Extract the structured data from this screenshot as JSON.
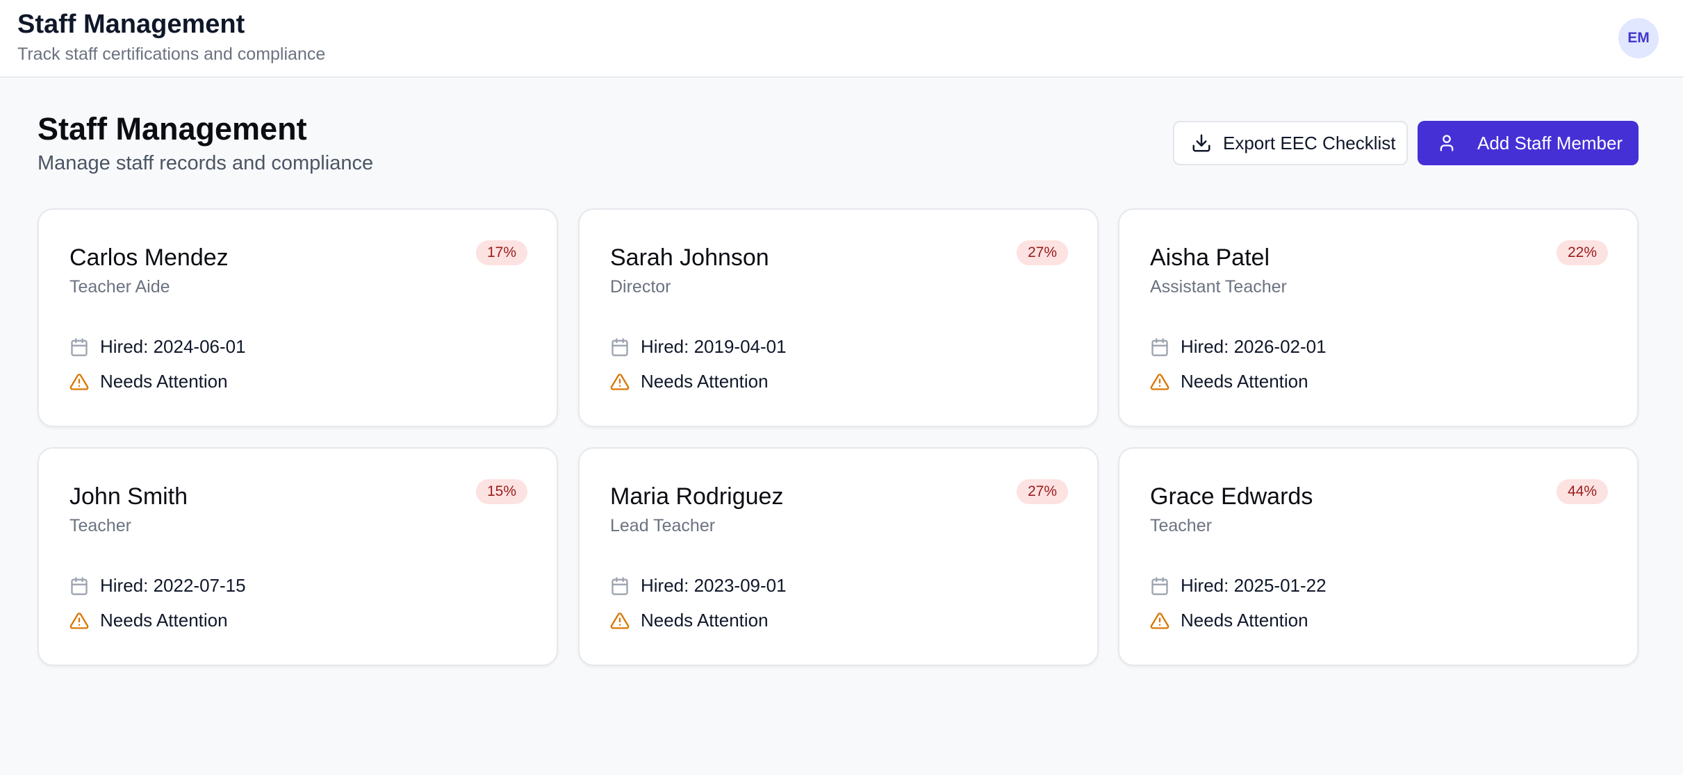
{
  "header": {
    "title": "Staff Management",
    "subtitle": "Track staff certifications and compliance",
    "avatar_initials": "EM"
  },
  "page": {
    "title": "Staff Management",
    "subtitle": "Manage staff records and compliance"
  },
  "actions": {
    "export_label": "Export EEC Checklist",
    "add_label": "Add Staff Member"
  },
  "colors": {
    "accent": "#4530d6",
    "badge_bg": "#fde2e2",
    "badge_text": "#991b1b",
    "warning": "#d97706"
  },
  "icons": {
    "export": "download-icon",
    "add": "user-icon",
    "hired": "calendar-icon",
    "status": "warning-triangle-icon"
  },
  "staff": [
    {
      "name": "Carlos Mendez",
      "role": "Teacher Aide",
      "percent": "17%",
      "hired": "Hired: 2024-06-01",
      "status": "Needs Attention"
    },
    {
      "name": "Sarah Johnson",
      "role": "Director",
      "percent": "27%",
      "hired": "Hired: 2019-04-01",
      "status": "Needs Attention"
    },
    {
      "name": "Aisha Patel",
      "role": "Assistant Teacher",
      "percent": "22%",
      "hired": "Hired: 2026-02-01",
      "status": "Needs Attention"
    },
    {
      "name": "John Smith",
      "role": "Teacher",
      "percent": "15%",
      "hired": "Hired: 2022-07-15",
      "status": "Needs Attention"
    },
    {
      "name": "Maria Rodriguez",
      "role": "Lead Teacher",
      "percent": "27%",
      "hired": "Hired: 2023-09-01",
      "status": "Needs Attention"
    },
    {
      "name": "Grace Edwards",
      "role": "Teacher",
      "percent": "44%",
      "hired": "Hired: 2025-01-22",
      "status": "Needs Attention"
    }
  ]
}
